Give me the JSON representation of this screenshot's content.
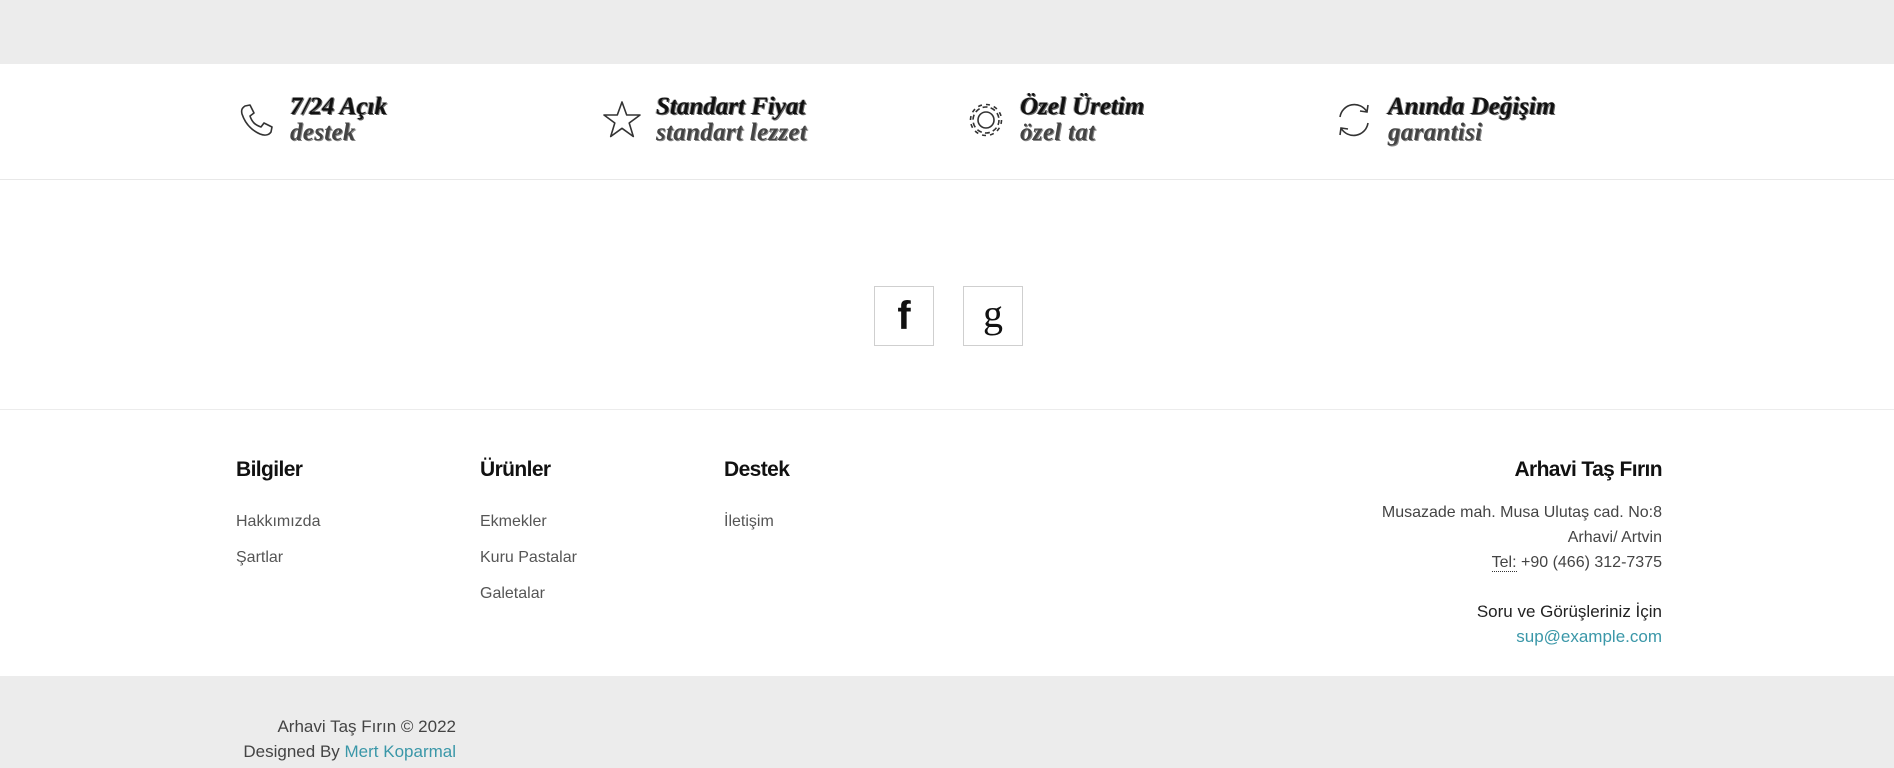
{
  "features": [
    {
      "title": "7/24 Açık",
      "subtitle": "destek",
      "icon": "phone-icon"
    },
    {
      "title": "Standart Fiyat",
      "subtitle": "standart lezzet",
      "icon": "star-icon"
    },
    {
      "title": "Özel Üretim",
      "subtitle": "özel tat",
      "icon": "gear-icon"
    },
    {
      "title": "Anında Değişim",
      "subtitle": "garantisi",
      "icon": "refresh-icon"
    }
  ],
  "social": {
    "facebook_glyph": "f",
    "google_glyph": "g"
  },
  "footer": {
    "bilgiler": {
      "title": "Bilgiler",
      "items": [
        "Hakkımızda",
        "Şartlar"
      ]
    },
    "urunler": {
      "title": "Ürünler",
      "items": [
        "Ekmekler",
        "Kuru Pastalar",
        "Galetalar"
      ]
    },
    "destek": {
      "title": "Destek",
      "items": [
        "İletişim"
      ]
    },
    "contact": {
      "title": "Arhavi Taş Fırın",
      "address_line1": "Musazade mah. Musa Ulutaş cad. No:8",
      "address_line2": "Arhavi/ Artvin",
      "tel_label": "Tel:",
      "tel_value": " +90 (466) 312-7375",
      "question": "Soru ve Görüşleriniz İçin",
      "email": "sup@example.com"
    }
  },
  "bottom": {
    "copyright": "Arhavi Taş Fırın © 2022",
    "designed_by": "Designed By",
    "designer": "Mert Koparmal"
  },
  "colors": {
    "accent": "#3a97a8",
    "band": "#ececec"
  }
}
